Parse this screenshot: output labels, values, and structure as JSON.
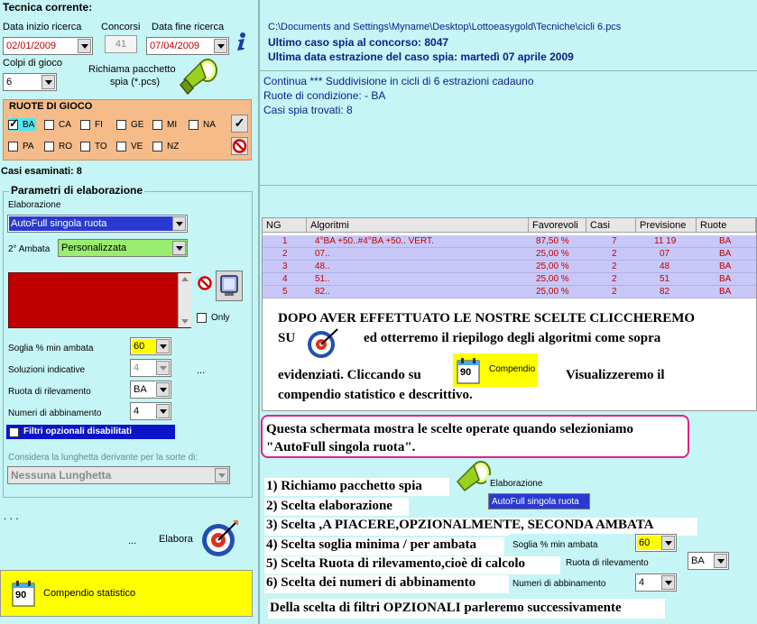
{
  "header": {
    "title": "Tecnica corrente:"
  },
  "search": {
    "data_inizio_label": "Data inizio ricerca",
    "data_inizio_value": "02/01/2009",
    "concorsi_label": "Concorsi",
    "concorsi_value": "41",
    "data_fine_label": "Data fine ricerca",
    "data_fine_value": "07/04/2009",
    "colpi_label": "Colpi di gioco",
    "colpi_value": "6",
    "richiama_label_1": "Richiama pacchetto",
    "richiama_label_2": "spia (*.pcs)"
  },
  "info": {
    "path": "C:\\Documents and Settings\\Myname\\Desktop\\Lottoeasygold\\Tecniche\\cicli 6.pcs",
    "ultimo_caso": "Ultimo caso spia al concorso:  8047",
    "ultima_data": "Ultima data estrazione del caso spia: martedì 07 aprile 2009"
  },
  "results_text": {
    "line1": "Continua *** Suddivisione in cicli di  6 estrazioni cadauno",
    "line2": "Ruote di condizione:  - BA",
    "line3": "Casi spia trovati: 8"
  },
  "ruote": {
    "title": "RUOTE DI GIOCO",
    "row1": [
      "BA",
      "CA",
      "FI",
      "GE",
      "MI",
      "NA"
    ],
    "row2": [
      "PA",
      "RO",
      "TO",
      "VE",
      "NZ"
    ],
    "check_mark": "✓"
  },
  "casi": "Casi esaminati: 8",
  "params": {
    "title": "Parametri di elaborazione",
    "elaborazione_label": "Elaborazione",
    "elaborazione_value": "AutoFull singola ruota",
    "ambata_label": "2° Ambata",
    "ambata_value": "Personalizzata",
    "only_label": "Only",
    "soglia_label": "Soglia % min ambata",
    "soglia_value": "60",
    "soluzioni_label": "Soluzioni indicative",
    "soluzioni_value": "4",
    "ellipsis": "...",
    "ruota_label": "Ruota di rilevamento",
    "ruota_value": "BA",
    "numeri_label": "Numeri di abbinamento",
    "numeri_value": "4",
    "filtri_label": "Filtri opzionali disabilitati",
    "lunghetta_label": "Considera la lunghetta derivante per la sorte di:",
    "lunghetta_value": "Nessuna Lunghetta"
  },
  "bottom": {
    "dots": ". . .",
    "dots2": "...",
    "elabora_label": "Elabora",
    "compendio_label": "Compendio statistico",
    "compendio_num": "90"
  },
  "table": {
    "headers": [
      "NG",
      "Algoritmi",
      "Favorevoli",
      "Casi",
      "Previsione",
      "Ruote"
    ],
    "rows": [
      {
        "ng": "1",
        "alg": "4°BA +50..#4°BA +50.. VERT.",
        "fav": "87,50 %",
        "casi": "7",
        "prev": "11 19",
        "ruote": "BA"
      },
      {
        "ng": "2",
        "alg": "07..",
        "fav": "25,00 %",
        "casi": "2",
        "prev": "07",
        "ruote": "BA"
      },
      {
        "ng": "3",
        "alg": "48..",
        "fav": "25,00 %",
        "casi": "2",
        "prev": "48",
        "ruote": "BA"
      },
      {
        "ng": "4",
        "alg": "51..",
        "fav": "25,00 %",
        "casi": "2",
        "prev": "51",
        "ruote": "BA"
      },
      {
        "ng": "5",
        "alg": "82..",
        "fav": "25,00 %",
        "casi": "2",
        "prev": "82",
        "ruote": "BA"
      }
    ]
  },
  "annotation1": {
    "line1": "DOPO AVER EFFETTUATO LE NOSTRE SCELTE CLICCHEREMO",
    "su": "SU",
    "line2b": "ed otterremo il riepilogo degli algoritmi come sopra",
    "line3a": "evidenziati. Cliccando su",
    "compendio": "Compendio",
    "line3b": "Visualizzeremo il",
    "line4": "compendio statistico e descrittivo."
  },
  "annotation2": {
    "line1": "Questa schermata mostra le scelte operate quando selezioniamo",
    "line2": "\"AutoFull singola ruota\"."
  },
  "steps": {
    "s1": "1) Richiamo pacchetto spia",
    "s2": "2) Scelta elaborazione",
    "s3": "3) Scelta ,A PIACERE,OPZIONALMENTE, SECONDA AMBATA",
    "s4": "4) Scelta soglia minima / per ambata",
    "s5": "5) Scelta Ruota di rilevamento,cioè di calcolo",
    "s6": "6) Scelta dei numeri di abbinamento",
    "footer": "Della scelta di filtri OPZIONALI parleremo successivamente",
    "elab_label": "Elaborazione",
    "elab_value": "AutoFull singola ruota",
    "soglia_label": "Soglia % min ambata",
    "soglia_value": "60",
    "ruota_label": "Ruota di rilevamento",
    "ruota_value": "BA",
    "numeri_label": "Numeri di abbinamento",
    "numeri_value": "4"
  }
}
